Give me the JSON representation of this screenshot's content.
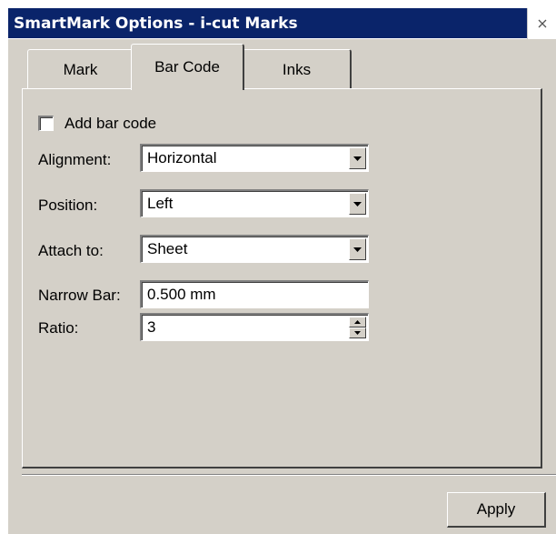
{
  "window": {
    "title": "SmartMark Options - i-cut Marks",
    "close_icon": "close-icon"
  },
  "tabs": [
    {
      "label": "Mark",
      "active": false
    },
    {
      "label": "Bar Code",
      "active": true
    },
    {
      "label": "Inks",
      "active": false
    }
  ],
  "barcode": {
    "add_bar_code": {
      "label": "Add bar code",
      "checked": false
    },
    "alignment": {
      "label": "Alignment:",
      "value": "Horizontal"
    },
    "position": {
      "label": "Position:",
      "value": "Left"
    },
    "attach_to": {
      "label": "Attach to:",
      "value": "Sheet"
    },
    "narrow_bar": {
      "label": "Narrow Bar:",
      "value": "0.500 mm"
    },
    "ratio": {
      "label": "Ratio:",
      "value": "3"
    }
  },
  "footer": {
    "apply_label": "Apply"
  }
}
